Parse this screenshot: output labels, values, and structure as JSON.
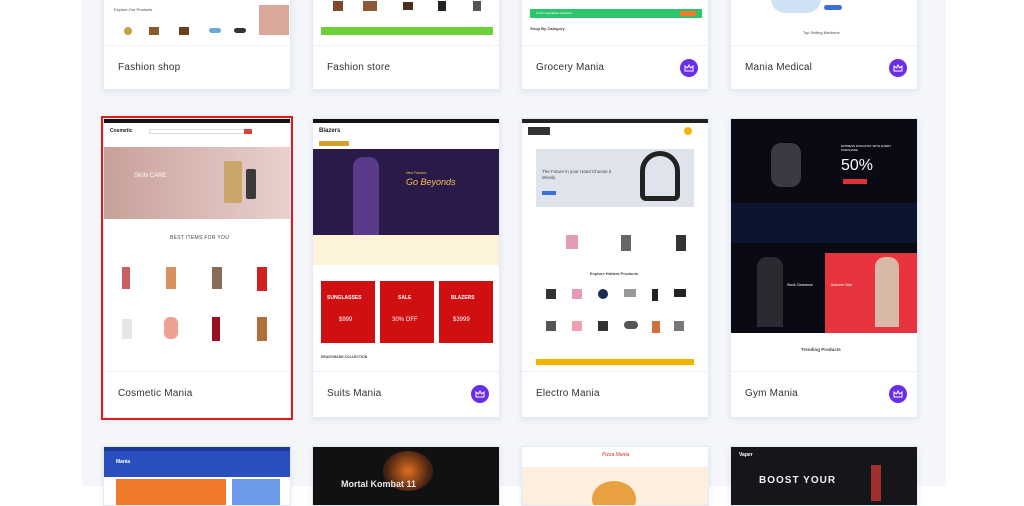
{
  "cards_row1": [
    {
      "name": "Fashion shop",
      "premium": false
    },
    {
      "name": "Fashion store",
      "premium": false
    },
    {
      "name": "Grocery Mania",
      "premium": true
    },
    {
      "name": "Mania Medical",
      "premium": true
    }
  ],
  "cards_row2": [
    {
      "name": "Cosmetic Mania",
      "premium": false,
      "selected": true
    },
    {
      "name": "Suits Mania",
      "premium": true
    },
    {
      "name": "Electro Mania",
      "premium": false
    },
    {
      "name": "Gym Mania",
      "premium": true
    }
  ],
  "thumbs": {
    "fashion_shop": {
      "section": "Explore Our Products"
    },
    "grocery": {
      "banner": "Fresh vegetables collection",
      "section": "Shop By Category"
    },
    "medical": {
      "section": "Top Selling Medicine"
    },
    "cosmetic": {
      "logo": "Cosmetic",
      "hero": "SKIN CARE",
      "section": "BEST ITEMS FOR YOU"
    },
    "suits": {
      "logo": "Blazers",
      "hero": "Go Beyonds",
      "hero_sub": "New Fashion",
      "tiles": [
        "SUNGLASSES",
        "SALE",
        "BLAZERS"
      ],
      "tile_values": [
        "$999",
        "30% OFF",
        "$3999"
      ],
      "section": "READYMADE COLLECTION"
    },
    "electro": {
      "hero": "The Future in your Hand Choose it Wisely",
      "section": "Explore Hottest Products"
    },
    "gym": {
      "hero_pct": "50%",
      "hero_tag": "EXPRESS DISCOUNT WITH EVERY PURCHASE",
      "banner": "Stock Clearance",
      "banner2": "Summer Sale",
      "section": "Trending Products"
    },
    "row3": [
      {
        "logo": "Mania"
      },
      {
        "hero": "Mortal Kombat 11"
      },
      {
        "logo": "Pizza Mania"
      },
      {
        "logo": "Vaper",
        "hero": "BOOST YOUR"
      }
    ]
  }
}
